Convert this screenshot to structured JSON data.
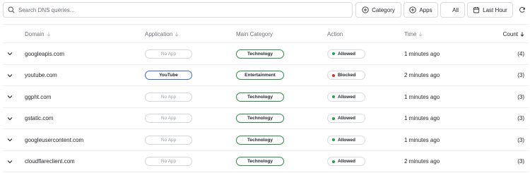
{
  "search": {
    "placeholder": "Search DNS queries..."
  },
  "filters": {
    "category_label": "Category",
    "apps_label": "Apps",
    "all_label": "All",
    "time_label": "Last Hour"
  },
  "columns": {
    "domain": "Domain",
    "application": "Application",
    "main_category": "Main Category",
    "action": "Action",
    "time": "Time",
    "count": "Count"
  },
  "colors": {
    "allowed": "#22a04b",
    "blocked": "#d93025",
    "category_border": "#2e8a4a",
    "app_border": "#3a6ad8"
  },
  "rows": [
    {
      "domain": "googleapis.com",
      "application": "No App",
      "app_known": false,
      "category": "Technology",
      "action": "Allowed",
      "time": "1 minutes ago",
      "count": "(4)"
    },
    {
      "domain": "youtube.com",
      "application": "YouTube",
      "app_known": true,
      "category": "Entertainment",
      "action": "Blocked",
      "time": "2 minutes ago",
      "count": "(3)"
    },
    {
      "domain": "ggpht.com",
      "application": "No App",
      "app_known": false,
      "category": "Technology",
      "action": "Allowed",
      "time": "1 minutes ago",
      "count": "(3)"
    },
    {
      "domain": "gstatic.com",
      "application": "No App",
      "app_known": false,
      "category": "Technology",
      "action": "Allowed",
      "time": "1 minutes ago",
      "count": "(3)"
    },
    {
      "domain": "googleusercontent.com",
      "application": "No App",
      "app_known": false,
      "category": "Technology",
      "action": "Allowed",
      "time": "1 minutes ago",
      "count": "(3)"
    },
    {
      "domain": "cloudflareclient.com",
      "application": "No App",
      "app_known": false,
      "category": "Technology",
      "action": "Allowed",
      "time": "2 minutes ago",
      "count": "(3)"
    }
  ]
}
